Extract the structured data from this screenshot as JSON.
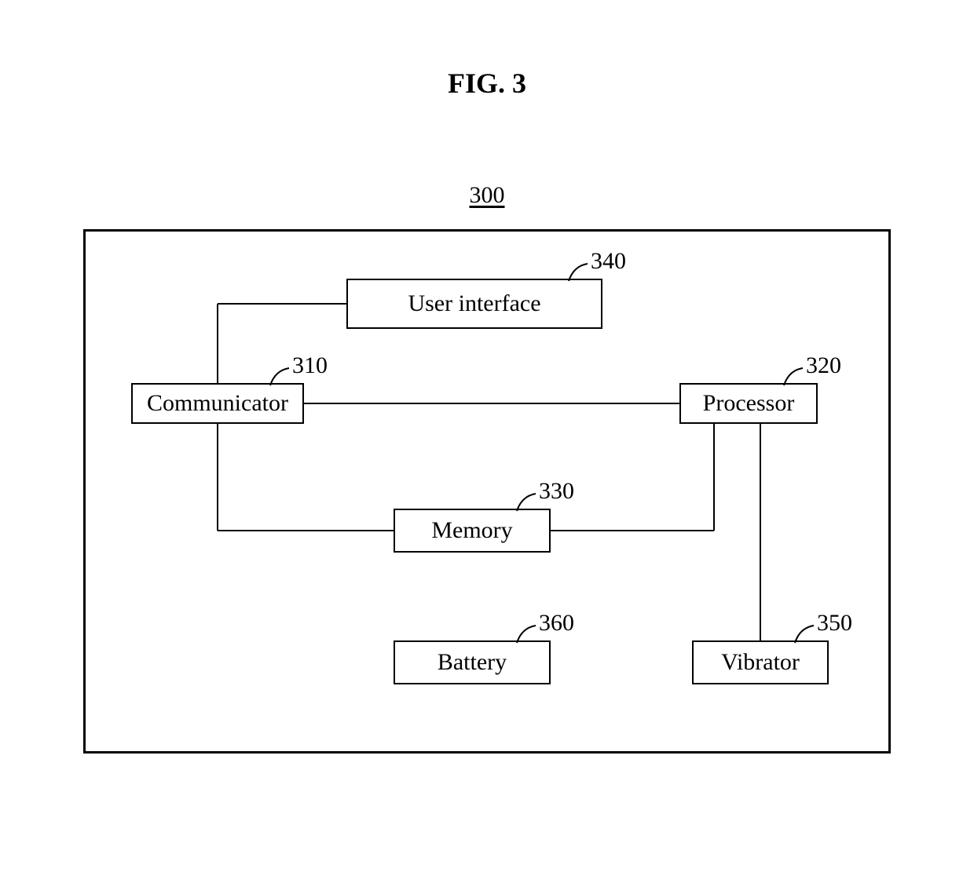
{
  "figure": {
    "title": "FIG. 3",
    "ref_top": "300"
  },
  "nodes": {
    "communicator": {
      "label": "Communicator",
      "ref": "310"
    },
    "processor": {
      "label": "Processor",
      "ref": "320"
    },
    "memory": {
      "label": "Memory",
      "ref": "330"
    },
    "user_interface": {
      "label": "User interface",
      "ref": "340"
    },
    "vibrator": {
      "label": "Vibrator",
      "ref": "350"
    },
    "battery": {
      "label": "Battery",
      "ref": "360"
    }
  }
}
